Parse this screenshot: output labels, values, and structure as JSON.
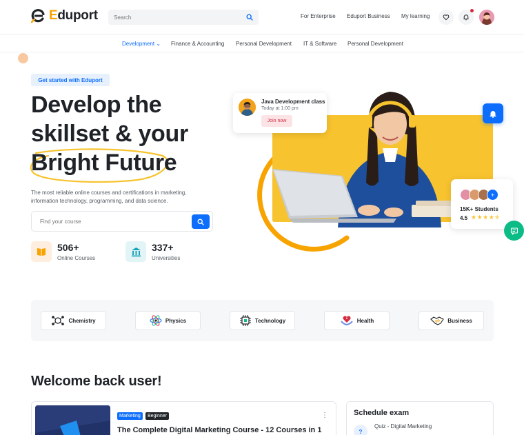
{
  "brand": {
    "name_first": "E",
    "name_rest": "duport"
  },
  "search": {
    "placeholder": "Search"
  },
  "topnav": {
    "enterprise": "For Enterprise",
    "business": "Eduport Business",
    "learning": "My learning"
  },
  "categories": [
    {
      "label": "Development"
    },
    {
      "label": "Finance & Accounting"
    },
    {
      "label": "Personal Development"
    },
    {
      "label": "IT & Software"
    },
    {
      "label": "Personal Development"
    }
  ],
  "hero": {
    "pill": "Get started with Eduport",
    "line1": "Develop the",
    "line2": "skillset & your",
    "line3": "Bright Future",
    "description_line1": "The most reliable online courses and certifications in marketing,",
    "description_line2": "information technology, programming, and data science.",
    "course_search_placeholder": "Find your course"
  },
  "stats": [
    {
      "value": "506+",
      "label": "Online Courses"
    },
    {
      "value": "337+",
      "label": "Universities"
    }
  ],
  "java_card": {
    "title": "Java Development class",
    "time": "Today at 1:00 pm",
    "button": "Join now"
  },
  "students_card": {
    "count": "15K+ Students",
    "rating": "4.5",
    "stars": "★★★★✯"
  },
  "subjects": [
    {
      "label": "Chemistry"
    },
    {
      "label": "Physics"
    },
    {
      "label": "Technology"
    },
    {
      "label": "Health"
    },
    {
      "label": "Business"
    }
  ],
  "welcome": "Welcome back user!",
  "course": {
    "badge1": "Marketing",
    "badge2": "Beginner",
    "title": "The Complete Digital Marketing Course - 12 Courses in 1",
    "more": "⋮"
  },
  "exam": {
    "title": "Schedule exam",
    "item": "Quiz - Digital Marketing",
    "item_icon": "?"
  },
  "colors": {
    "primary": "#0d6efd",
    "accent": "#f7c32e",
    "orange": "#f7a300",
    "success": "#0cbc87",
    "danger": "#d6293e"
  }
}
